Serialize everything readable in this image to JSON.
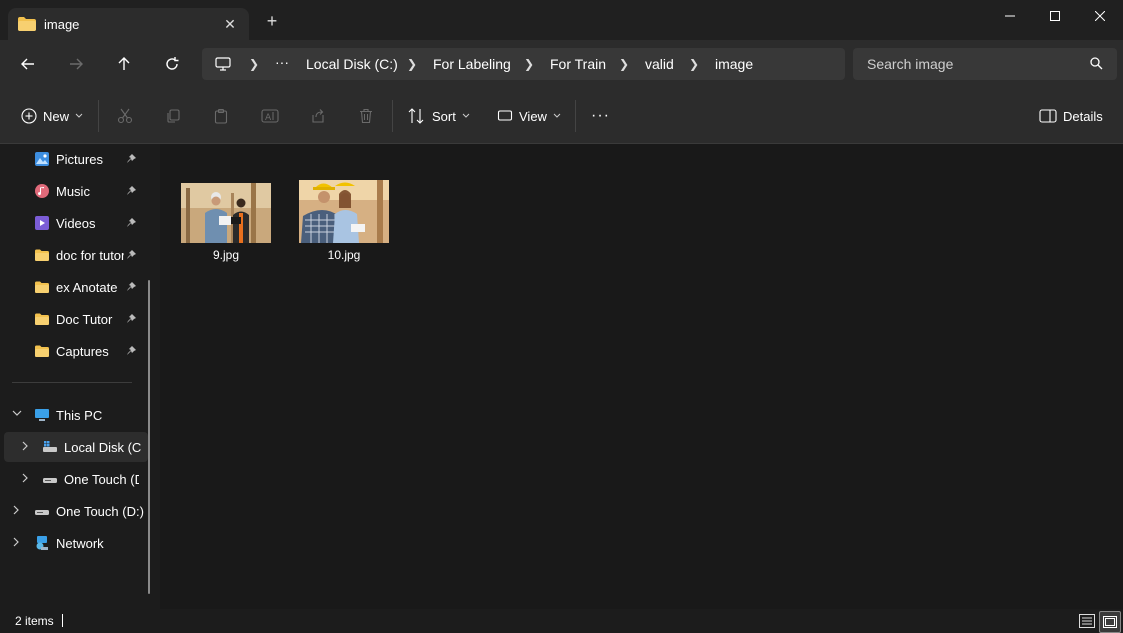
{
  "window": {
    "tab_title": "image",
    "new_tab": "+",
    "close_tab": "✕"
  },
  "breadcrumb": {
    "overflow": "···",
    "items": [
      "Local Disk (C:)",
      "For Labeling",
      "For Train",
      "valid",
      "image"
    ]
  },
  "search": {
    "placeholder": "Search image"
  },
  "toolbar": {
    "new_label": "New",
    "sort_label": "Sort",
    "view_label": "View",
    "more_label": "···",
    "details_label": "Details"
  },
  "sidebar": {
    "quick_access": [
      {
        "label": "Pictures",
        "icon": "pictures-icon"
      },
      {
        "label": "Music",
        "icon": "music-icon"
      },
      {
        "label": "Videos",
        "icon": "videos-icon"
      },
      {
        "label": "doc for tutor",
        "icon": "folder-icon"
      },
      {
        "label": "ex Anotate",
        "icon": "folder-icon"
      },
      {
        "label": "Doc Tutor",
        "icon": "folder-icon"
      },
      {
        "label": "Captures",
        "icon": "folder-icon"
      }
    ],
    "this_pc": "This PC",
    "local_disk": "Local Disk (C:)",
    "one_touch_sub": "One Touch (D:)",
    "one_touch": "One Touch (D:)",
    "network": "Network"
  },
  "files": [
    {
      "name": "9.jpg"
    },
    {
      "name": "10.jpg"
    }
  ],
  "status": {
    "items_count": "2 items"
  },
  "colors": {
    "accent_folder": "#f2c14e",
    "background": "#191919",
    "chrome": "#2c2c2c"
  }
}
